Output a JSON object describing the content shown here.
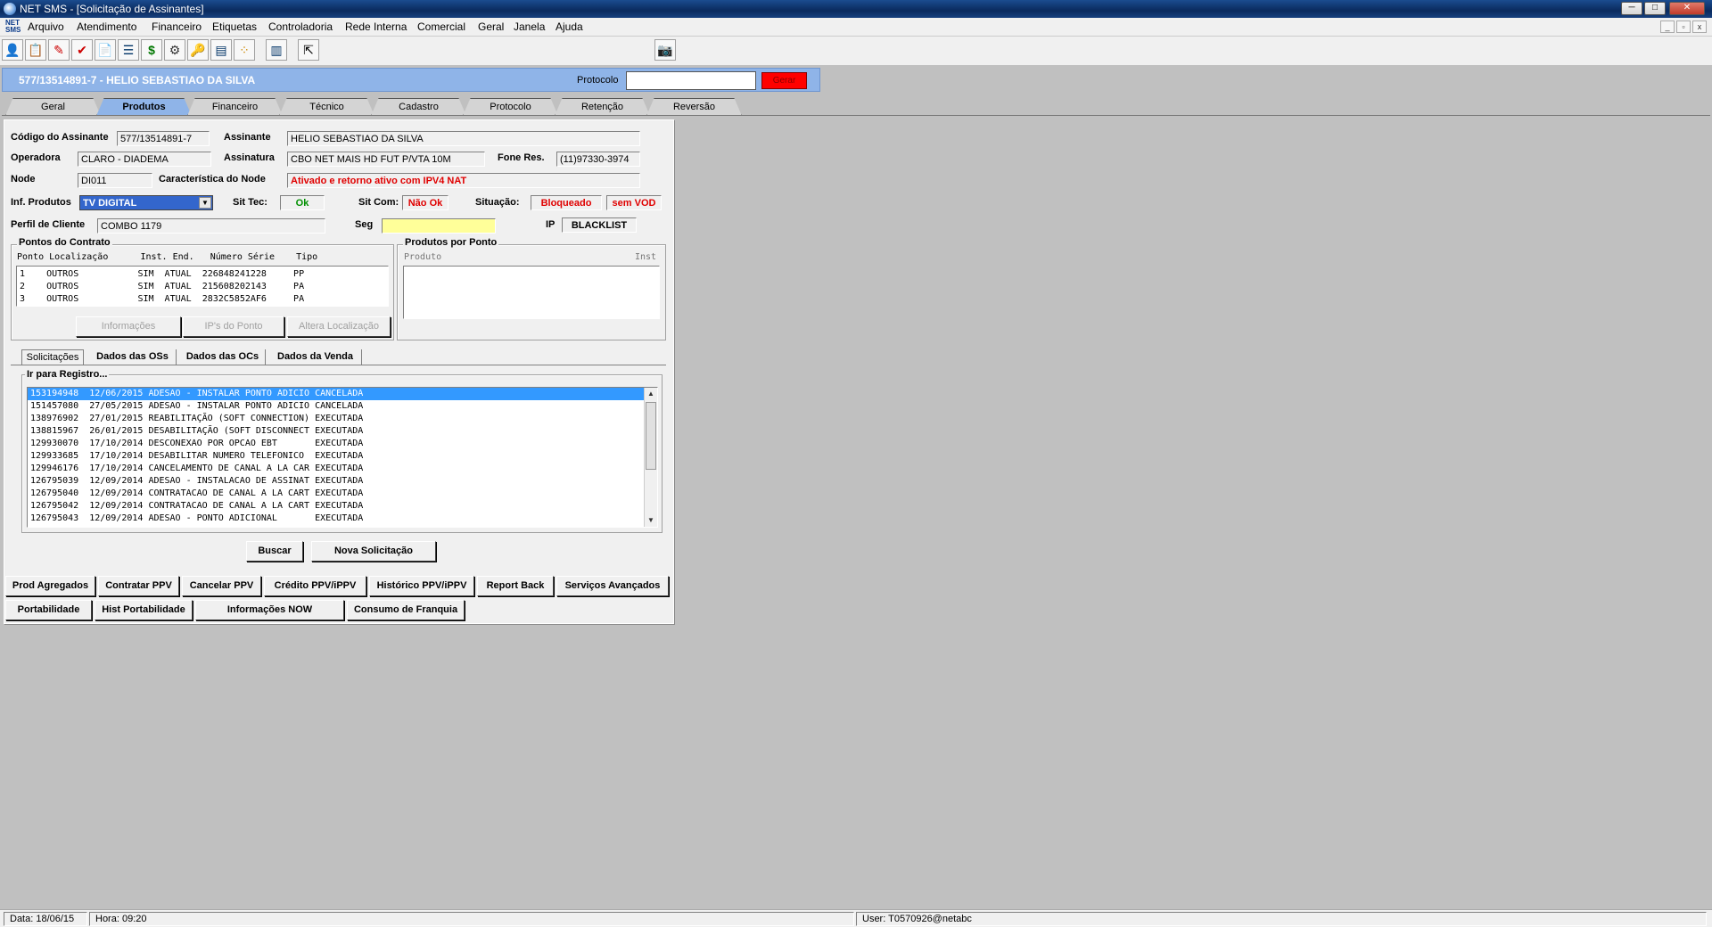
{
  "window": {
    "title": "NET SMS - [Solicitação de Assinantes]",
    "controls": {
      "minimize": "─",
      "maximize": "□",
      "close": "✕"
    }
  },
  "menu": {
    "icon_text": "NET\nSMS",
    "items": [
      "Arquivo",
      "Atendimento",
      "Financeiro",
      "Etiquetas",
      "Controladoria",
      "Rede Interna",
      "Comercial",
      "Geral",
      "Janela",
      "Ajuda"
    ],
    "mdi_controls": [
      "_",
      "▫",
      "x"
    ]
  },
  "toolbar": {
    "icons": [
      "person-icon",
      "checklist-icon",
      "pen-icon",
      "reports-icon",
      "document-icon",
      "list-icon",
      "money-icon",
      "tools-icon",
      "key-icon",
      "calc-icon",
      "bell-icon",
      "phone-icon",
      "exit-icon",
      "camera-icon"
    ],
    "glyphs": [
      "👤",
      "📋",
      "✎",
      "✔",
      "📄",
      "☰",
      "$",
      "⚙",
      "🔑",
      "▤",
      "⁘",
      "▥",
      "⇱",
      "📷"
    ]
  },
  "header": {
    "subscriber": "577/13514891-7 - HELIO SEBASTIAO DA SILVA",
    "protocol_label": "Protocolo",
    "protocol_value": "",
    "generate_button": "Gerar"
  },
  "tabs": [
    "Geral",
    "Produtos",
    "Financeiro",
    "Técnico",
    "Cadastro",
    "Protocolo",
    "Retenção",
    "Reversão"
  ],
  "active_tab": "Produtos",
  "fields": {
    "codigo_label": "Código do Assinante",
    "codigo": "577/13514891-7",
    "assinante_label": "Assinante",
    "assinante": "HELIO SEBASTIAO DA SILVA",
    "operadora_label": "Operadora",
    "operadora": "CLARO - DIADEMA",
    "assinatura_label": "Assinatura",
    "assinatura": "CBO NET MAIS HD FUT P/VTA 10M",
    "fone_label": "Fone Res.",
    "fone": "(11)97330-3974",
    "node_label": "Node",
    "node": "DI011",
    "caract_label": "Característica do Node",
    "caract": "Ativado e retorno ativo com IPV4 NAT",
    "infprod_label": "Inf. Produtos",
    "infprod": "TV DIGITAL",
    "sittec_label": "Sit Tec:",
    "sittec": "Ok",
    "sitcom_label": "Sit Com:",
    "sitcom": "Não Ok",
    "situacao_label": "Situação:",
    "situacao": "Bloqueado",
    "vod": "sem VOD",
    "perfil_label": "Perfil de Cliente",
    "perfil": "COMBO 1179",
    "seg_label": "Seg",
    "seg": "",
    "ip_label": "IP",
    "ip": "BLACKLIST"
  },
  "pontos": {
    "title": "Pontos do Contrato",
    "header": "Ponto Localização      Inst. End.   Número Série    Tipo",
    "rows": [
      "1    OUTROS           SIM  ATUAL  226848241228     PP",
      "2    OUTROS           SIM  ATUAL  215608202143     PA",
      "3    OUTROS           SIM  ATUAL  2832C5852AF6     PA"
    ],
    "buttons": [
      "Informações",
      "IP's do Ponto",
      "Altera Localização"
    ]
  },
  "produtos_ponto": {
    "title": "Produtos por Ponto",
    "col_produto": "Produto",
    "col_inst": "Inst"
  },
  "subtabs": [
    "Solicitações",
    "Dados das OSs",
    "Dados das OCs",
    "Dados da Venda"
  ],
  "solicitacoes": {
    "group_title": "Ir para Registro...",
    "rows": [
      "153194948  12/06/2015 ADESAO - INSTALAR PONTO ADICIO CANCELADA",
      "151457080  27/05/2015 ADESAO - INSTALAR PONTO ADICIO CANCELADA",
      "138976902  27/01/2015 REABILITAÇÃO (SOFT CONNECTION) EXECUTADA",
      "138815967  26/01/2015 DESABILITAÇÃO (SOFT DISCONNECT EXECUTADA",
      "129930070  17/10/2014 DESCONEXAO POR OPCAO EBT       EXECUTADA",
      "129933685  17/10/2014 DESABILITAR NUMERO TELEFONICO  EXECUTADA",
      "129946176  17/10/2014 CANCELAMENTO DE CANAL A LA CAR EXECUTADA",
      "126795039  12/09/2014 ADESAO - INSTALACAO DE ASSINAT EXECUTADA",
      "126795040  12/09/2014 CONTRATACAO DE CANAL A LA CART EXECUTADA",
      "126795042  12/09/2014 CONTRATACAO DE CANAL A LA CART EXECUTADA",
      "126795043  12/09/2014 ADESAO - PONTO ADICIONAL       EXECUTADA"
    ],
    "buscar": "Buscar",
    "nova": "Nova Solicitação"
  },
  "bottom_buttons_row1": [
    "Prod Agregados",
    "Contratar PPV",
    "Cancelar PPV",
    "Crédito PPV/iPPV",
    "Histórico PPV/iPPV",
    "Report Back",
    "Serviços Avançados"
  ],
  "bottom_buttons_row2": [
    "Portabilidade",
    "Hist Portabilidade",
    "Informações NOW",
    "Consumo de Franquia"
  ],
  "status": {
    "data": "Data: 18/06/15",
    "hora": "Hora: 09:20",
    "user": "User:  T0570926@netabc"
  },
  "colors": {
    "header_bg": "#8fb4e8",
    "selection": "#3399ff",
    "alert_red": "#e00000",
    "ok_green": "#009000"
  }
}
